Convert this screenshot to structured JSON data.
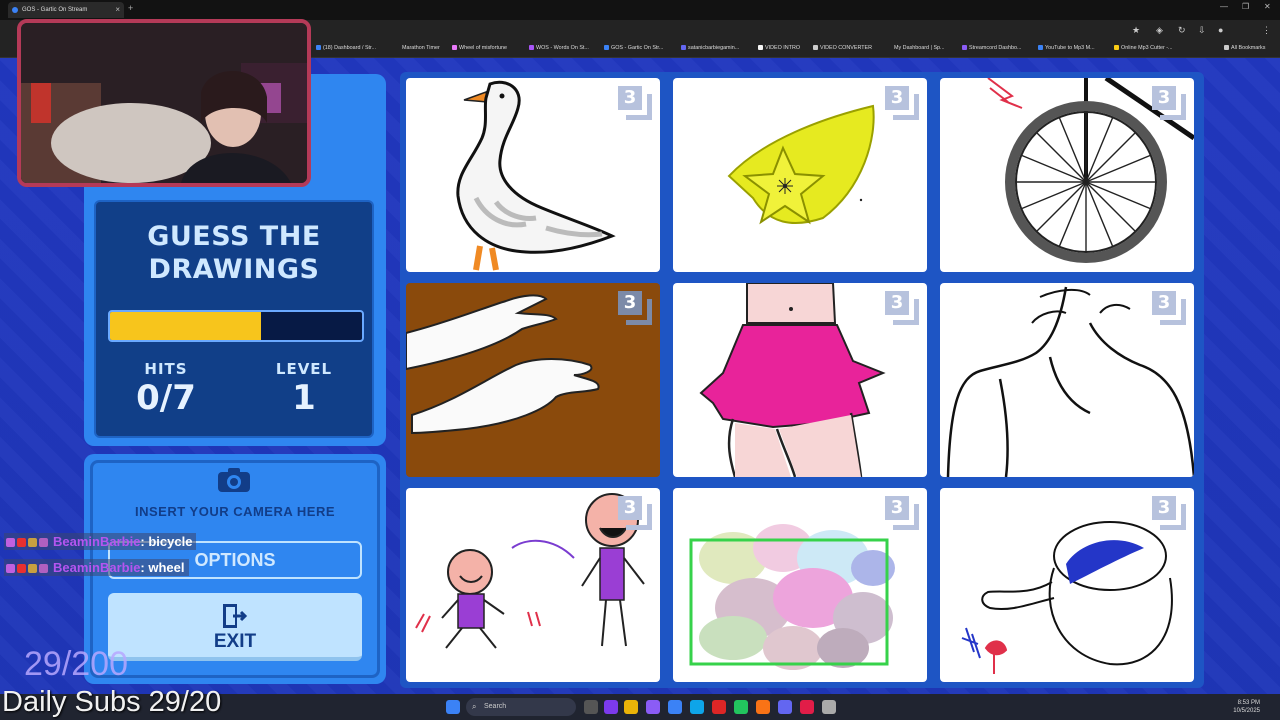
{
  "browser": {
    "tab_title": "GOS - Gartic On Stream",
    "tab_close": "×",
    "new_tab": "+",
    "window_controls": [
      "—",
      "❐",
      "✕"
    ],
    "bookmarks": [
      {
        "label": "(18) Dashboard / Str...",
        "color": "#3b82f6"
      },
      {
        "label": "Marathon Timer",
        "color": "#888888"
      },
      {
        "label": "Wheel of misfortune",
        "color": "#e879f9"
      },
      {
        "label": "WOS - Words On St...",
        "color": "#a855f7"
      },
      {
        "label": "GOS - Gartic On Str...",
        "color": "#3b82f6"
      },
      {
        "label": "satanicbarbiegamin...",
        "color": "#6366f1"
      },
      {
        "label": "VIDEO INTRO",
        "color": "#f5f5f5"
      },
      {
        "label": "VIDEO CONVERTER",
        "color": "#cccccc"
      },
      {
        "label": "My Dashboard | Sp...",
        "color": "#888888"
      },
      {
        "label": "Streamcord Dashbo...",
        "color": "#8b5cf6"
      },
      {
        "label": "YouTube to Mp3 M...",
        "color": "#3b82f6"
      },
      {
        "label": "Online Mp3 Cutter -...",
        "color": "#facc15"
      },
      {
        "label": "All Bookmarks",
        "color": "#cccccc"
      }
    ]
  },
  "game": {
    "title_line1": "GUESS THE",
    "title_line2": "DRAWINGS",
    "progress_fraction": 0.6,
    "hits_label": "HITS",
    "hits_value": "0/7",
    "level_label": "LEVEL",
    "level_value": "1",
    "camera_text": "INSERT YOUR CAMERA HERE",
    "options_label": "OPTIONS",
    "exit_label": "EXIT",
    "drawings": [
      {
        "subject": "goose",
        "badge": "3"
      },
      {
        "subject": "starfruit",
        "badge": "3"
      },
      {
        "subject": "bicycle-wheel",
        "badge": "3"
      },
      {
        "subject": "hands",
        "badge": "3"
      },
      {
        "subject": "skirt",
        "badge": "3"
      },
      {
        "subject": "man-sketch",
        "badge": "3"
      },
      {
        "subject": "kids-ball",
        "badge": "3"
      },
      {
        "subject": "color-blur",
        "badge": "3"
      },
      {
        "subject": "teapot",
        "badge": "3"
      }
    ]
  },
  "overlay": {
    "chat": [
      {
        "user": "BeaminBarbie",
        "message": ": bicycle"
      },
      {
        "user": "BeaminBarbie",
        "message": ": wheel"
      }
    ],
    "sub_count": "29/200",
    "daily_subs": "Daily Subs 29/20"
  },
  "taskbar": {
    "search_placeholder": "Search",
    "time": "8:53 PM",
    "date": "10/5/2025"
  },
  "colors": {
    "page_bg": "#1f36b8",
    "panel": "#2f86f0",
    "panel_dark": "#113f88",
    "progress": "#f7c51c",
    "webcam_border": "#b43a58",
    "chat_user": "#b455f0"
  }
}
